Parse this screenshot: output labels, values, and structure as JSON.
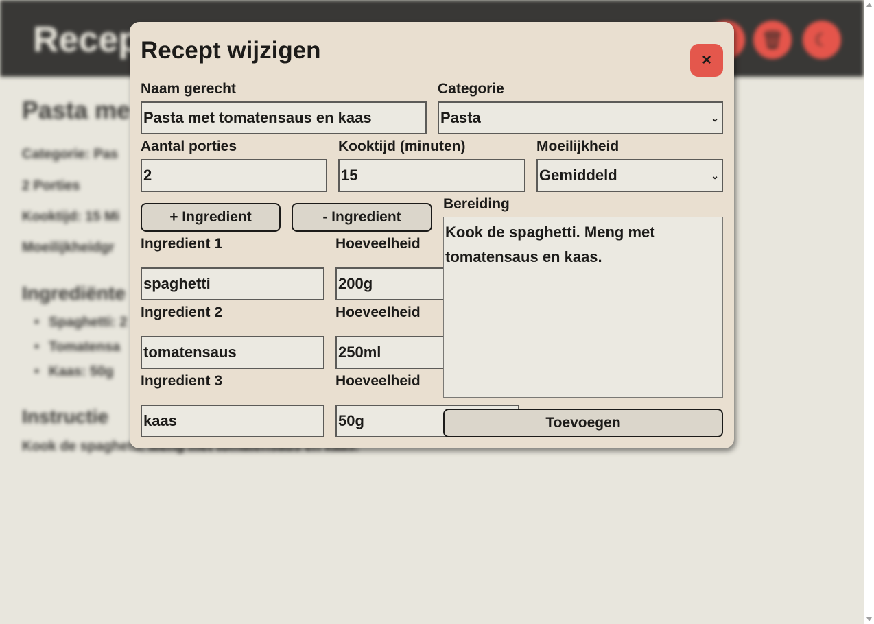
{
  "background": {
    "app_title": "Recep",
    "header_buttons": [
      {
        "icon": "pencil-icon",
        "glyph": "✎"
      },
      {
        "icon": "trash-icon",
        "glyph": "🗑"
      },
      {
        "icon": "moon-icon",
        "glyph": "☾"
      }
    ],
    "recipe_title": "Pasta me",
    "category_line": "Categorie: Pas",
    "portions_line": "2 Porties",
    "cooktime_line": "Kooktijd: 15 Mi",
    "difficulty_line": "Moeilijkheidgr",
    "ingredients_heading": "Ingrediënte",
    "ingredients": [
      "Spaghetti: 2",
      "Tomatensa",
      "Kaas: 50g"
    ],
    "instructions_heading": "Instructie",
    "instructions_text": "Kook de spaghetti. Meng met tomatensaus en kaas."
  },
  "modal": {
    "title": "Recept wijzigen",
    "close_label": "×",
    "name_label": "Naam gerecht",
    "name_value": "Pasta met tomatensaus en kaas",
    "category_label": "Categorie",
    "category_value": "Pasta",
    "portions_label": "Aantal porties",
    "portions_value": "2",
    "cooktime_label": "Kooktijd (minuten)",
    "cooktime_value": "15",
    "difficulty_label": "Moeilijkheid",
    "difficulty_value": "Gemiddeld",
    "add_ingredient_label": "+ Ingredient",
    "remove_ingredient_label": "- Ingredient",
    "preparation_label": "Bereiding",
    "preparation_value": "Kook de spaghetti. Meng met tomatensaus en kaas.",
    "ingredients": [
      {
        "label": "Ingredient 1",
        "value": "spaghetti",
        "amount_label": "Hoeveelheid",
        "amount_value": "200g"
      },
      {
        "label": "Ingredient 2",
        "value": "tomatensaus",
        "amount_label": "Hoeveelheid",
        "amount_value": "250ml"
      },
      {
        "label": "Ingredient 3",
        "value": "kaas",
        "amount_label": "Hoeveelheid",
        "amount_value": "50g"
      }
    ],
    "submit_label": "Toevoegen"
  },
  "colors": {
    "page_bg": "#e8e6dd",
    "header_bg": "#393836",
    "modal_bg": "#e9dfd0",
    "accent_red": "#e4574c",
    "field_bg": "#ebe9e1",
    "button_bg": "#dbd6cb"
  }
}
